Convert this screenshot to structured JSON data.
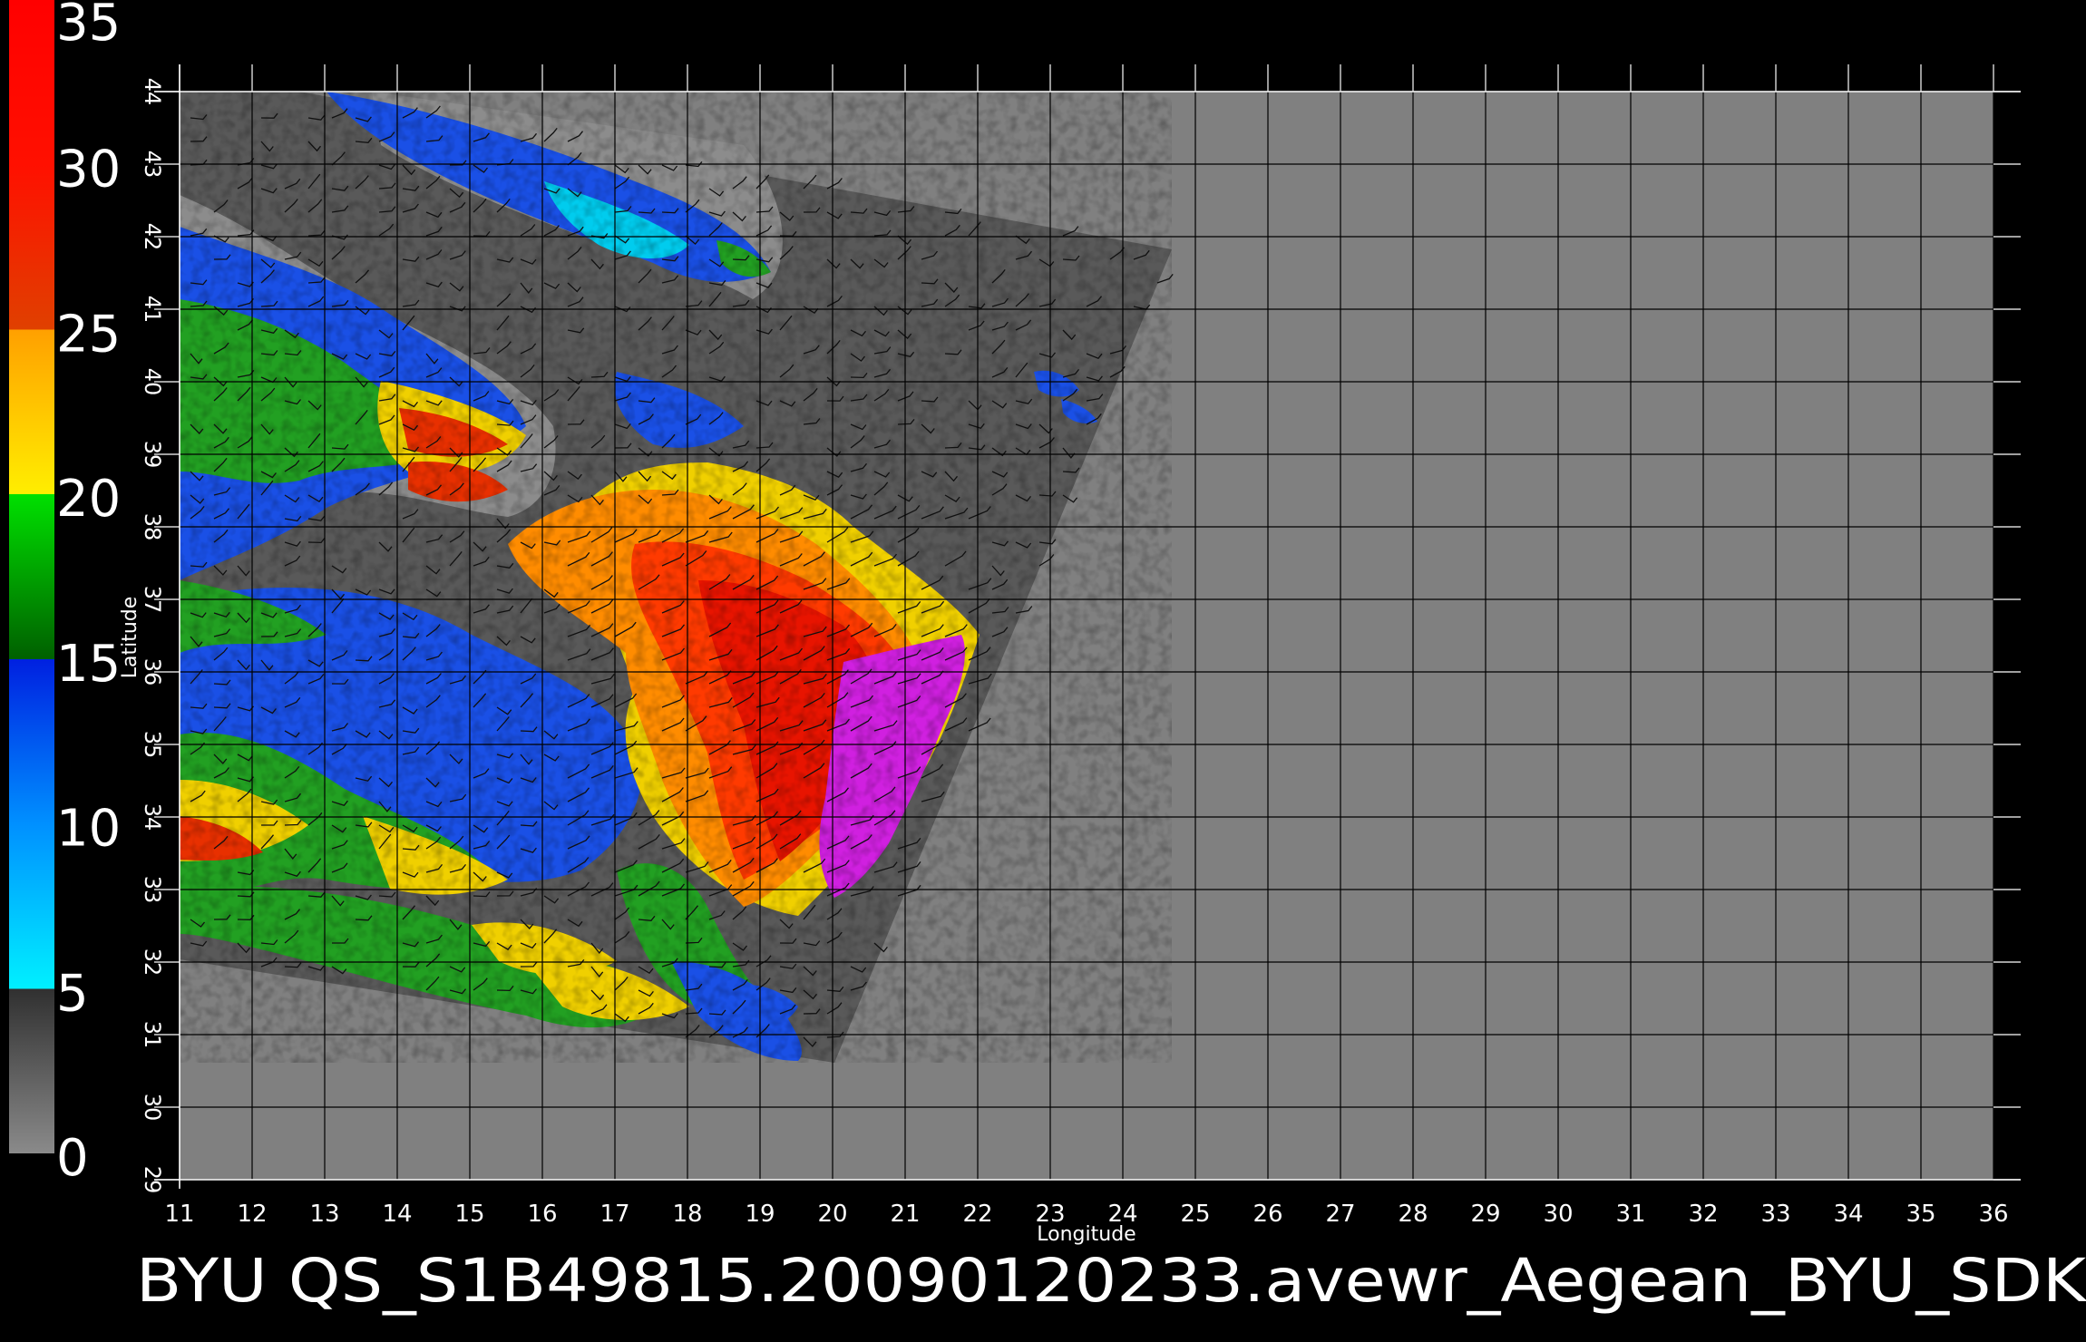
{
  "map": {
    "title": "BYU  QS_S1B49815.20090120233.avewr_Aegean_BYU_SDK",
    "x_axis_label": "Longitude",
    "y_axis_label": "Latitude",
    "lon_range": [
      11,
      36
    ],
    "lat_range": [
      29,
      44
    ],
    "lon_ticks": [
      "11",
      "12",
      "13",
      "14",
      "15",
      "16",
      "17",
      "18",
      "19",
      "20",
      "21",
      "22",
      "23",
      "24",
      "25",
      "26",
      "27",
      "28",
      "29",
      "30",
      "31",
      "32",
      "33",
      "34",
      "35",
      "36"
    ],
    "lat_ticks": [
      "29",
      "30",
      "31",
      "32",
      "33",
      "34",
      "35",
      "36",
      "37",
      "38",
      "39",
      "40",
      "41",
      "42",
      "43",
      "44"
    ],
    "background_color": "#000000",
    "plot_fill": "#808080",
    "swath_fill": "#595959",
    "grid_color": "#000000"
  },
  "colorbar": {
    "labels": [
      "35",
      "30",
      "25",
      "20",
      "15",
      "10",
      "5",
      "0"
    ],
    "stops": [
      {
        "value": 0,
        "color": "#8a8a8a"
      },
      {
        "value": 5,
        "color": "#303030"
      },
      {
        "value": 5,
        "color": "#00f0ff"
      },
      {
        "value": 10,
        "color": "#0090ff"
      },
      {
        "value": 15,
        "color": "#0020e0"
      },
      {
        "value": 15,
        "color": "#006000"
      },
      {
        "value": 20,
        "color": "#00e000"
      },
      {
        "value": 20,
        "color": "#ffee00"
      },
      {
        "value": 25,
        "color": "#ffa000"
      },
      {
        "value": 25,
        "color": "#e04000"
      },
      {
        "value": 30,
        "color": "#ff1000"
      },
      {
        "value": 35,
        "color": "#ff0000"
      },
      {
        "value": 35,
        "color": "#c07050"
      }
    ]
  }
}
